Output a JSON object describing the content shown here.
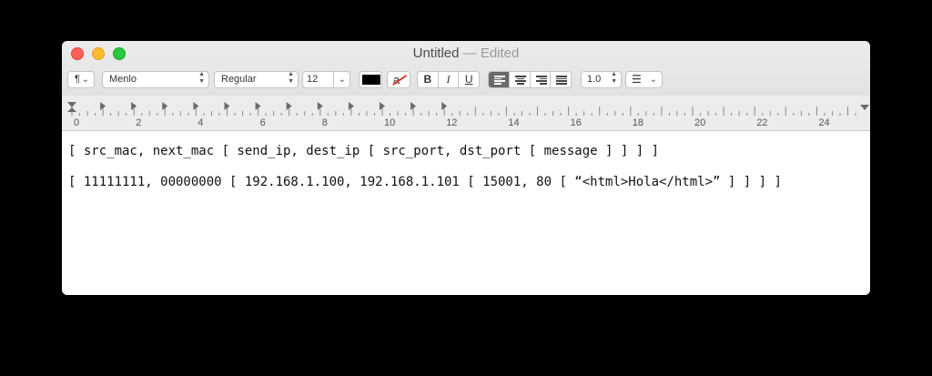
{
  "window": {
    "title": "Untitled",
    "title_separator": "—",
    "title_status": "Edited"
  },
  "toolbar": {
    "paragraph_style": "¶",
    "font_family": "Menlo",
    "font_style": "Regular",
    "font_size": "12",
    "text_color": "#000000",
    "background_color_glyph": "a",
    "bold_label": "B",
    "italic_label": "I",
    "underline_label": "U",
    "alignment_selected": "left",
    "line_spacing": "1.0",
    "list_icon": "list-bullets-icon"
  },
  "ruler": {
    "labels": [
      "0",
      "2",
      "4",
      "6",
      "8",
      "10",
      "12",
      "14",
      "16",
      "18",
      "20",
      "22",
      "24"
    ]
  },
  "document": {
    "lines": [
      "[ src_mac, next_mac [ send_ip, dest_ip [ src_port, dst_port [ message ] ] ] ]",
      "[ 11111111, 00000000 [ 192.168.1.100, 192.168.1.101 [ 15001, 80 [ “<html>Hola</html>” ] ] ] ]"
    ]
  },
  "colors": {
    "close": "#fe5f57",
    "minimize": "#febc2e",
    "maximize": "#28c840",
    "segment_active": "#6a6a6a"
  }
}
